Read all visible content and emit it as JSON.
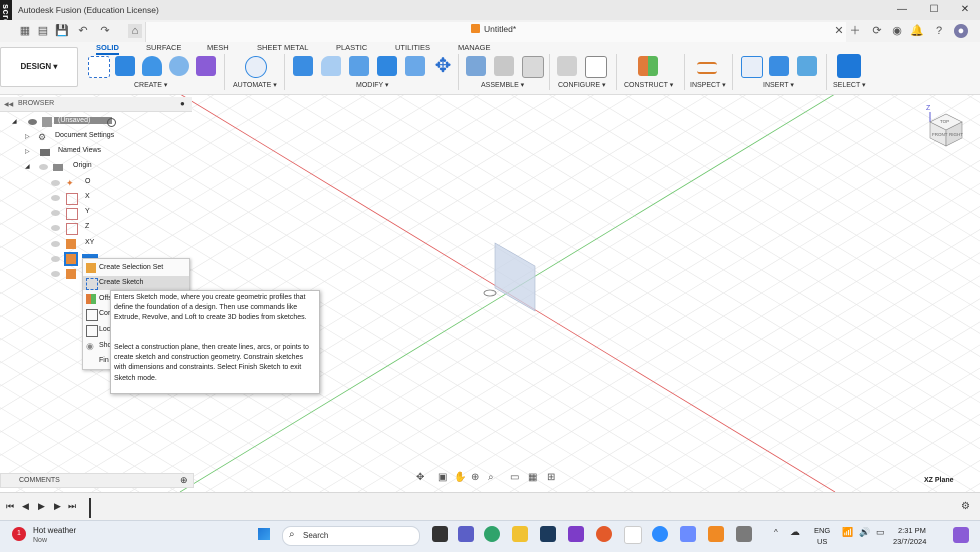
{
  "window": {
    "title": "Autodesk Fusion (Education License)"
  },
  "recorder": {
    "label": "screenrec"
  },
  "document": {
    "tab_title": "Untitled*"
  },
  "workspace": {
    "label": "DESIGN ▾"
  },
  "tabs": [
    "SOLID",
    "SURFACE",
    "MESH",
    "SHEET METAL",
    "PLASTIC",
    "UTILITIES",
    "MANAGE"
  ],
  "groups": [
    "CREATE ▾",
    "AUTOMATE ▾",
    "MODIFY ▾",
    "ASSEMBLE ▾",
    "CONFIGURE ▾",
    "CONSTRUCT ▾",
    "INSPECT ▾",
    "INSERT ▾",
    "SELECT ▾"
  ],
  "browser": {
    "header": "BROWSER",
    "items": [
      "(Unsaved)",
      "Document Settings",
      "Named Views",
      "Origin",
      "O",
      "X",
      "Y",
      "Z",
      "XY"
    ]
  },
  "context_menu": {
    "items": [
      "Create Selection Set",
      "Create Sketch",
      "Offs",
      "Cor",
      "Loc",
      "Sho",
      "Fin"
    ]
  },
  "tooltip": {
    "para1": "Enters Sketch mode, where you create geometric profiles that define the foundation of a design. Then use commands like Extrude, Revolve, and Loft to create 3D bodies from sketches.",
    "para2": "Select a construction plane, then create lines, arcs, or points to create sketch and construction geometry. Constrain sketches with dimensions and constraints. Select Finish Sketch to exit Sketch mode."
  },
  "viewcube": {
    "faces": [
      "TOP",
      "FRONT",
      "RIGHT"
    ],
    "axis": "Z"
  },
  "comments": {
    "label": "COMMENTS"
  },
  "status": {
    "selection": "XZ Plane"
  },
  "taskbar": {
    "weather_title": "Hot weather",
    "weather_sub": "Now",
    "weather_badge": "1",
    "search_placeholder": "Search",
    "lang": "ENG",
    "region": "US",
    "time": "2:31 PM",
    "date": "23/7/2024"
  },
  "colors": {
    "accent": "#0a64c8",
    "x_axis": "#e05a5a",
    "y_axis": "#6cc56c",
    "plane": "#c8d4e8"
  }
}
